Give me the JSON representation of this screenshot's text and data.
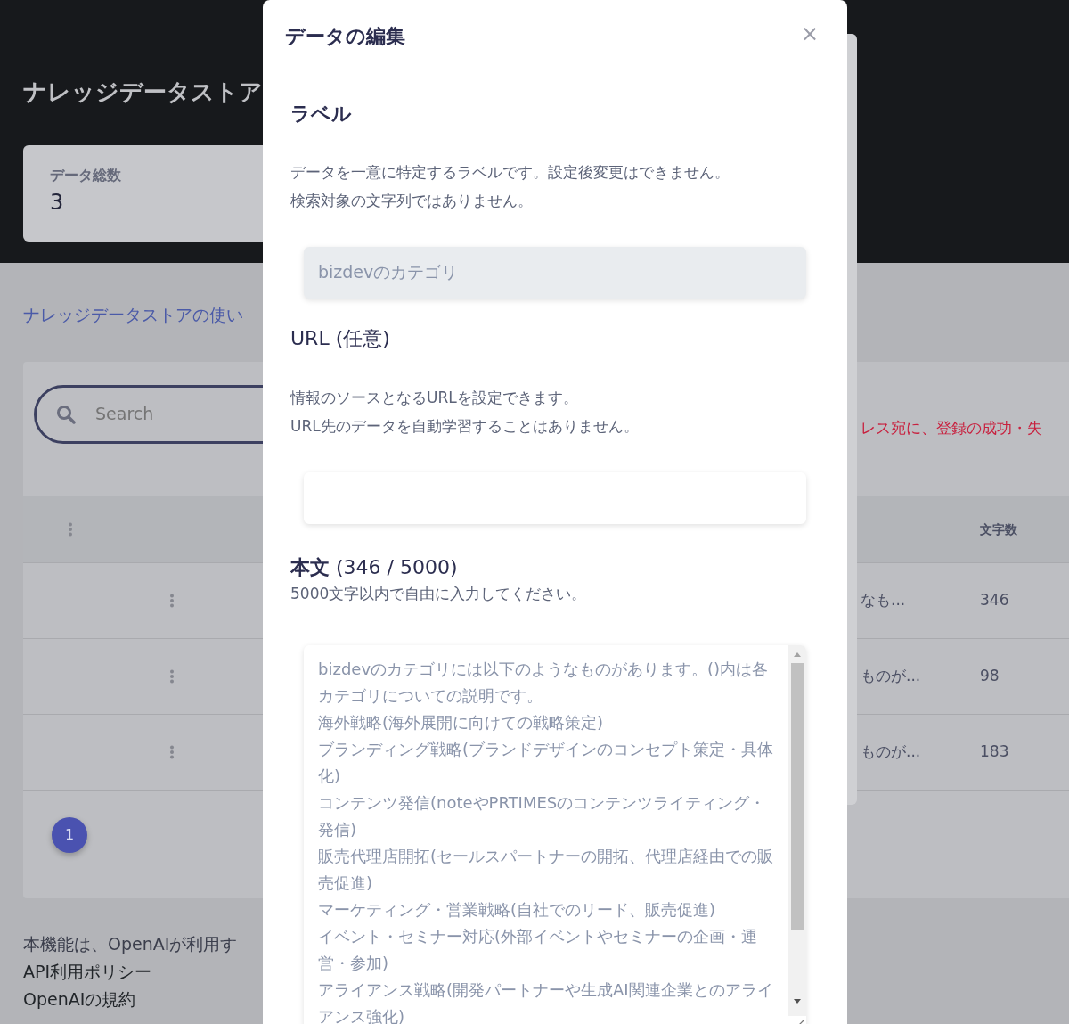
{
  "page": {
    "title": "ナレッジデータストア",
    "stat": {
      "label": "データ総数",
      "value": "3"
    },
    "guide_link": "ナレッジデータストアの使い",
    "search": {
      "placeholder": "Search"
    },
    "notice": "レス宛に、登録の成功・失",
    "table": {
      "columns": [
        {
          "label": "文字数"
        }
      ],
      "rows": [
        {
          "column_3": "なも...",
          "count": "346"
        },
        {
          "column_3": "ものが...",
          "count": "98"
        },
        {
          "column_3": "ものが...",
          "count": "183"
        }
      ]
    },
    "pagination": [
      {
        "label": "1",
        "selected": true
      }
    ],
    "footer": {
      "text": "本機能は、OpenAIが利用す",
      "links": [
        "API利用ポリシー",
        "OpenAIの規約"
      ]
    }
  },
  "dialog": {
    "title": "データの編集",
    "close": "×",
    "sections": [
      {
        "kind": "input",
        "heading": "ラベル",
        "help": [
          "データを一意に特定するラベルです。設定後変更はできません。",
          "検索対象の文字列ではありません。"
        ],
        "value": "bizdevのカテゴリ",
        "disabled": true
      },
      {
        "kind": "input",
        "heading": "URL (任意)",
        "help": [
          "情報のソースとなるURLを設定できます。",
          "URL先のデータを自動学習することはありません。"
        ],
        "disabled": false
      },
      {
        "kind": "textarea",
        "heading": "**本文** (346 / 5000)",
        "help": [
          "5000文字以内で自由に入力してください。"
        ],
        "lines": [
          "bizdevのカテゴリには以下のようなものがあります。()内は各カテゴリについての説明です。",
          "海外戦略(海外展開に向けての戦略策定)",
          "ブランディング戦略(ブランドデザインのコンセプト策定・具体化)",
          "コンテンツ発信(noteやPRTIMESのコンテンツライティング・発信)",
          "販売代理店開拓(セールスパートナーの開拓、代理店経由での販売促進)",
          "マーケティング・営業戦略(自社でのリード、販売促進)",
          "イベント・セミナー対応(外部イベントやセミナーの企画・運営・参加)",
          "アライアンス戦略(開発パートナーや生成AI関連企業とのアライアンス強化)"
        ]
      }
    ]
  }
}
